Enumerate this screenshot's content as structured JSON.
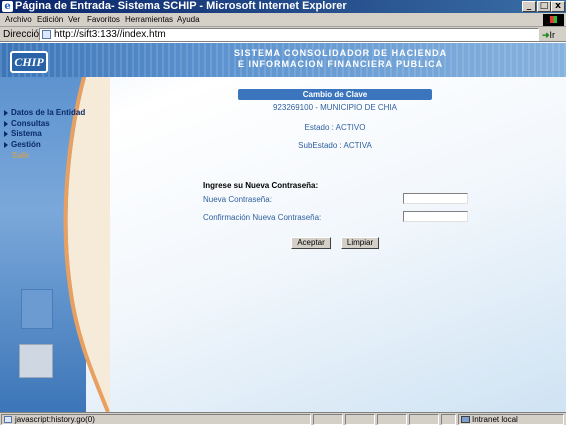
{
  "window": {
    "title": "Página de Entrada- Sistema SCHIP - Microsoft Internet Explorer",
    "controls": [
      "_",
      "□",
      "x"
    ]
  },
  "menu": [
    "Archivo",
    "Edición",
    "Ver",
    "Favoritos",
    "Herramientas",
    "Ayuda"
  ],
  "address": {
    "label": "Dirección",
    "url": "http://sift3:133//index.htm",
    "go_label": "Ir"
  },
  "header": {
    "logo": "CHIP",
    "line1": "SISTEMA CONSOLIDADOR DE HACIENDA",
    "line2": "E INFORMACION FINANCIERA PUBLICA"
  },
  "nav": {
    "items": [
      "Datos de la Entidad",
      "Consultas",
      "Sistema",
      "Gestión"
    ],
    "extra": "Salir"
  },
  "content": {
    "box_title": "Cambio de Clave",
    "entity": "923269100 - MUNICIPIO DE CHIA",
    "estado": "Estado : ACTIVO",
    "subestado": "SubEstado : ACTIVA",
    "prompt": "Ingrese su Nueva Contraseña:",
    "new_password_label": "Nueva Contraseña:",
    "confirm_label": "Confirmación Nueva Contraseña:",
    "new_password_value": "",
    "confirm_value": "",
    "accept_label": "Aceptar",
    "clear_label": "Limpiar"
  },
  "status": {
    "text": "javascript:history.go(0)",
    "zone": "Intranet local"
  }
}
